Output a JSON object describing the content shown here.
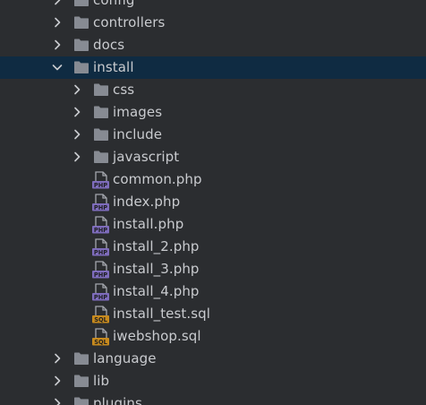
{
  "colors": {
    "background": "#2b2d30",
    "selection": "#0f2b42",
    "text": "#c9cbcf",
    "folder": "#878b93",
    "php_badge": "#7e6cbc",
    "sql_badge": "#c78a1e"
  },
  "tree": [
    {
      "label": "config",
      "type": "folder",
      "expanded": false,
      "depth": 0,
      "icon": "folder-icon"
    },
    {
      "label": "controllers",
      "type": "folder",
      "expanded": false,
      "depth": 0,
      "icon": "folder-icon"
    },
    {
      "label": "docs",
      "type": "folder",
      "expanded": false,
      "depth": 0,
      "icon": "folder-icon"
    },
    {
      "label": "install",
      "type": "folder",
      "expanded": true,
      "selected": true,
      "depth": 0,
      "icon": "folder-icon"
    },
    {
      "label": "css",
      "type": "folder",
      "expanded": false,
      "depth": 1,
      "icon": "folder-icon"
    },
    {
      "label": "images",
      "type": "folder",
      "expanded": false,
      "depth": 1,
      "icon": "folder-icon"
    },
    {
      "label": "include",
      "type": "folder",
      "expanded": false,
      "depth": 1,
      "icon": "folder-icon"
    },
    {
      "label": "javascript",
      "type": "folder",
      "expanded": false,
      "depth": 1,
      "icon": "folder-icon"
    },
    {
      "label": "common.php",
      "type": "file",
      "badge": "PHP",
      "depth": 1,
      "icon": "php-file-icon"
    },
    {
      "label": "index.php",
      "type": "file",
      "badge": "PHP",
      "depth": 1,
      "icon": "php-file-icon"
    },
    {
      "label": "install.php",
      "type": "file",
      "badge": "PHP",
      "depth": 1,
      "icon": "php-file-icon"
    },
    {
      "label": "install_2.php",
      "type": "file",
      "badge": "PHP",
      "depth": 1,
      "icon": "php-file-icon"
    },
    {
      "label": "install_3.php",
      "type": "file",
      "badge": "PHP",
      "depth": 1,
      "icon": "php-file-icon"
    },
    {
      "label": "install_4.php",
      "type": "file",
      "badge": "PHP",
      "depth": 1,
      "icon": "php-file-icon"
    },
    {
      "label": "install_test.sql",
      "type": "file",
      "badge": "SQL",
      "depth": 1,
      "icon": "sql-file-icon"
    },
    {
      "label": "iwebshop.sql",
      "type": "file",
      "badge": "SQL",
      "depth": 1,
      "icon": "sql-file-icon"
    },
    {
      "label": "language",
      "type": "folder",
      "expanded": false,
      "depth": 0,
      "icon": "folder-icon"
    },
    {
      "label": "lib",
      "type": "folder",
      "expanded": false,
      "depth": 0,
      "icon": "folder-icon"
    },
    {
      "label": "plugins",
      "type": "folder",
      "expanded": false,
      "depth": 0,
      "icon": "folder-icon"
    }
  ]
}
